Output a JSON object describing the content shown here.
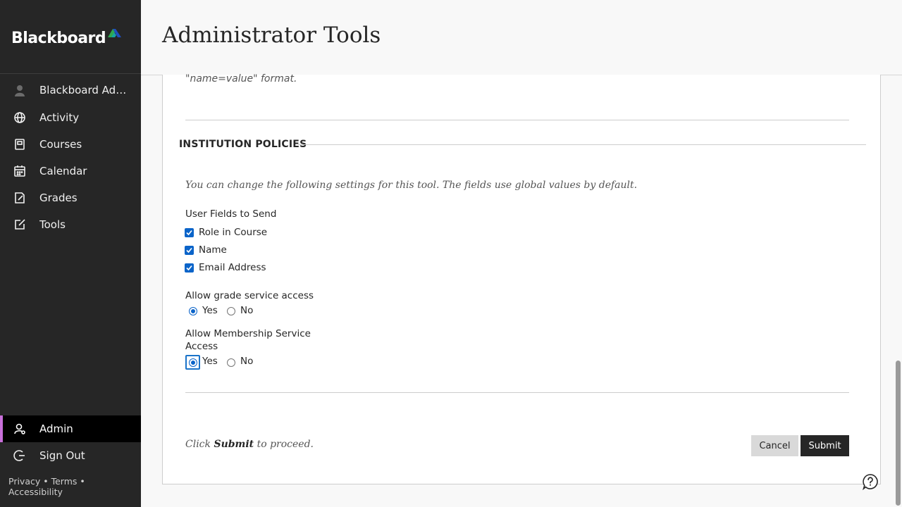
{
  "brand": {
    "name": "Blackboard",
    "accent": "#c86fd9",
    "link_blue": "#0b64c9"
  },
  "sidebar": {
    "items": [
      {
        "label": "Blackboard Adm...",
        "icon": "user-avatar-icon"
      },
      {
        "label": "Activity",
        "icon": "globe-icon"
      },
      {
        "label": "Courses",
        "icon": "courses-icon"
      },
      {
        "label": "Calendar",
        "icon": "calendar-icon"
      },
      {
        "label": "Grades",
        "icon": "grades-icon"
      },
      {
        "label": "Tools",
        "icon": "tools-icon"
      }
    ],
    "bottom_items": [
      {
        "label": "Admin",
        "icon": "admin-icon",
        "active": true
      },
      {
        "label": "Sign Out",
        "icon": "sign-out-icon"
      }
    ],
    "footer": {
      "privacy": "Privacy",
      "terms": "Terms",
      "accessibility": "Accessibility",
      "separator": "•"
    }
  },
  "header": {
    "title": "Administrator Tools"
  },
  "main": {
    "format_note": "\"name=value\" format.",
    "section_title": "INSTITUTION POLICIES",
    "intro": "You can change the following settings for this tool. The fields use global values by default.",
    "user_fields": {
      "label": "User Fields to Send",
      "options": [
        {
          "label": "Role in Course",
          "checked": true
        },
        {
          "label": "Name",
          "checked": true
        },
        {
          "label": "Email Address",
          "checked": true
        }
      ]
    },
    "grade_access": {
      "label": "Allow grade service access",
      "yes": "Yes",
      "no": "No",
      "selected": "Yes"
    },
    "membership_access": {
      "label_line1": "Allow Membership Service",
      "label_line2": "Access",
      "yes": "Yes",
      "no": "No",
      "selected": "Yes"
    },
    "proceed": {
      "prefix": "Click",
      "bold": "Submit",
      "suffix": "to proceed."
    },
    "buttons": {
      "cancel": "Cancel",
      "submit": "Submit"
    }
  }
}
